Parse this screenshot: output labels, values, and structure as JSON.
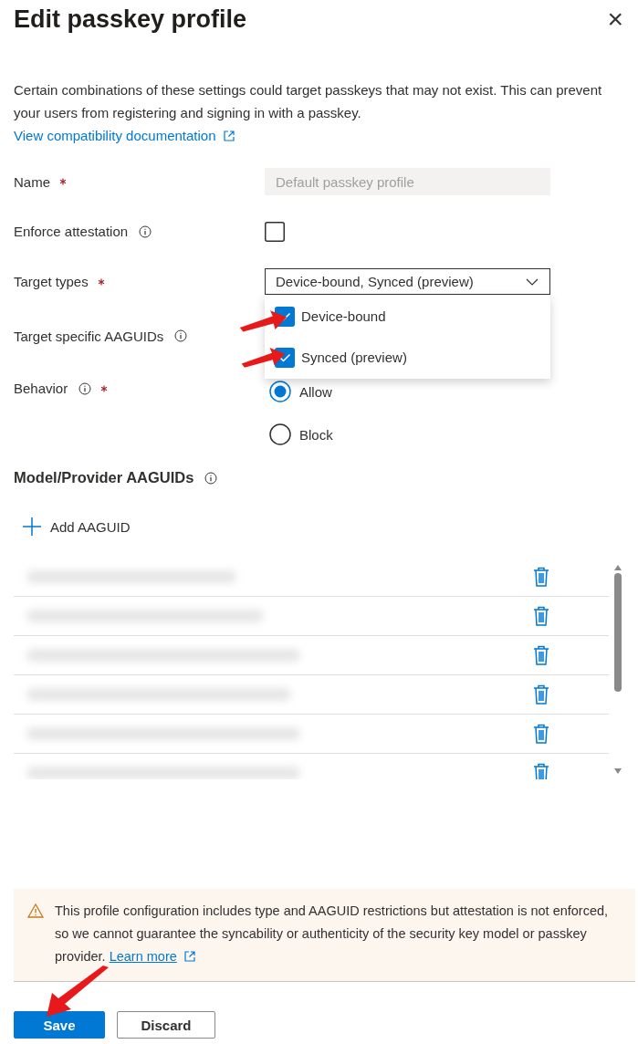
{
  "dialog": {
    "title": "Edit passkey profile",
    "close": "×"
  },
  "intro": {
    "text": "Certain combinations of these settings could target passkeys that may not exist. This can prevent your users from registering and signing in with a passkey.",
    "link": "View compatibility documentation"
  },
  "fields": [
    {
      "kind": "text",
      "label": "Name",
      "required": true,
      "info": false,
      "placeholder": "Default passkey profile",
      "disabled": true
    },
    {
      "kind": "checkbox",
      "label": "Enforce attestation",
      "required": false,
      "info": true,
      "checked": false
    },
    {
      "kind": "dropdown",
      "label": "Target types",
      "required": true,
      "info": false,
      "value": "Device-bound, Synced (preview)",
      "expanded": true,
      "options": [
        {
          "label": "Device-bound",
          "checked": true
        },
        {
          "label": "Synced (preview)",
          "checked": true
        }
      ]
    },
    {
      "kind": "hidden",
      "label": "Target specific AAGUIDs",
      "required": false,
      "info": true
    },
    {
      "kind": "radio",
      "label": "Behavior",
      "required": true,
      "info": true,
      "options": [
        {
          "label": "Allow",
          "selected": true
        },
        {
          "label": "Block",
          "selected": false
        }
      ]
    }
  ],
  "aaguids": {
    "title": "Model/Provider AAGUIDs",
    "add": "Add AAGUID",
    "rows": [
      {
        "kind": "redacted"
      },
      {
        "kind": "redacted"
      },
      {
        "kind": "redacted"
      },
      {
        "kind": "redacted"
      },
      {
        "kind": "redacted"
      },
      {
        "kind": "redacted"
      }
    ]
  },
  "warning": {
    "text": "This profile configuration includes type and AAGUID restrictions but attestation is not enforced, so we cannot guarantee the syncability or authenticity of the security key model or passkey provider.",
    "link": "Learn more"
  },
  "buttons": [
    {
      "label": "Save",
      "primary": true
    },
    {
      "label": "Discard",
      "primary": false
    }
  ]
}
